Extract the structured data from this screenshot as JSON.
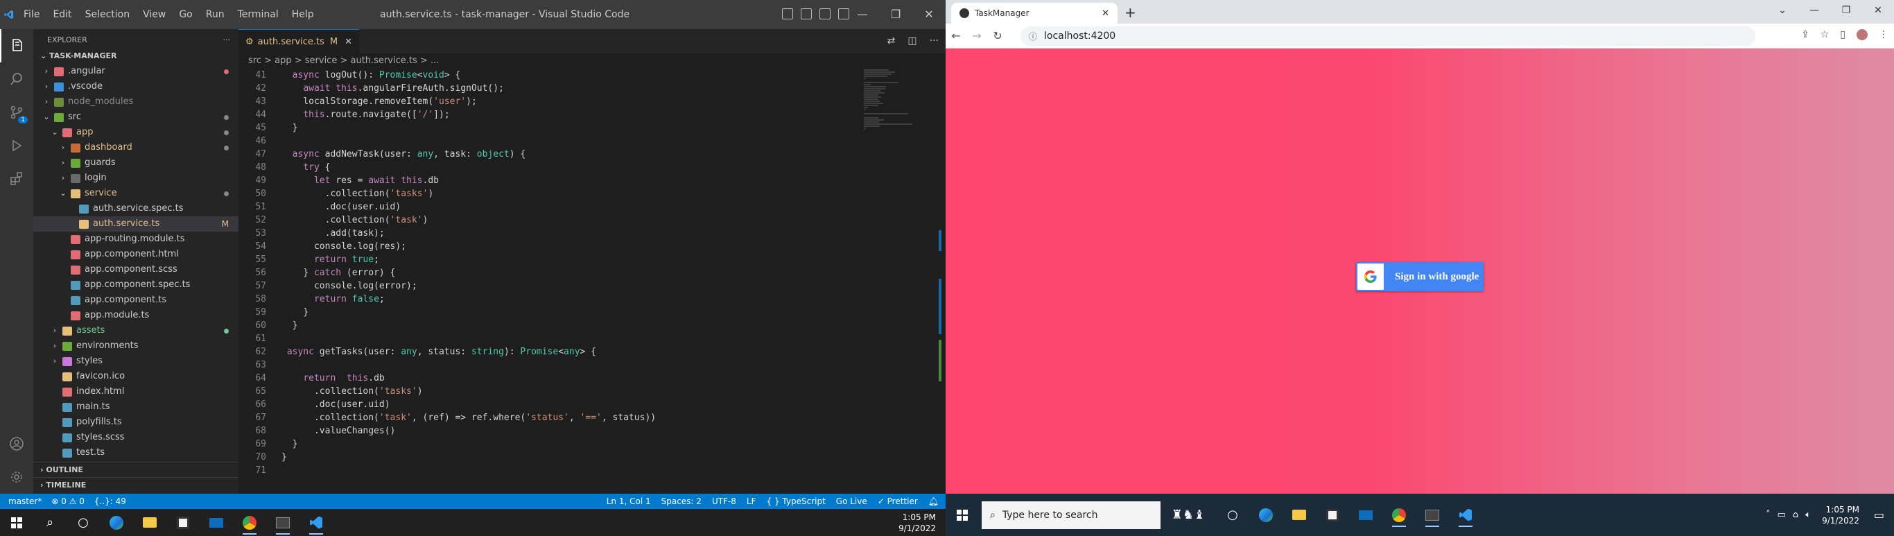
{
  "vscode": {
    "menu": [
      "File",
      "Edit",
      "Selection",
      "View",
      "Go",
      "Run",
      "Terminal",
      "Help"
    ],
    "window_title": "auth.service.ts - task-manager - Visual Studio Code",
    "explorer_label": "EXPLORER",
    "project_label": "TASK-MANAGER",
    "tree": [
      {
        "label": ".angular",
        "indent": 1,
        "chev": ">",
        "color": "#e06c75",
        "text": "#cccccc",
        "marker": "dot",
        "mcolor": "#e06c75"
      },
      {
        "label": ".vscode",
        "indent": 1,
        "chev": ">",
        "color": "#3c8fd6",
        "text": "#cccccc",
        "marker": "",
        "mcolor": ""
      },
      {
        "label": "node_modules",
        "indent": 1,
        "chev": ">",
        "color": "#6b8e3b",
        "text": "#8b8b8b",
        "marker": "",
        "mcolor": ""
      },
      {
        "label": "src",
        "indent": 1,
        "chev": "v",
        "color": "#6bab3e",
        "text": "#cccccc",
        "marker": "dot",
        "mcolor": "#888888"
      },
      {
        "label": "app",
        "indent": 2,
        "chev": "v",
        "color": "#e06c75",
        "text": "#e2c08d",
        "marker": "dot",
        "mcolor": "#888888"
      },
      {
        "label": "dashboard",
        "indent": 3,
        "chev": ">",
        "color": "#c76a3a",
        "text": "#e2c08d",
        "marker": "dot",
        "mcolor": "#888888"
      },
      {
        "label": "guards",
        "indent": 3,
        "chev": ">",
        "color": "#6bab3e",
        "text": "#cccccc",
        "marker": "",
        "mcolor": ""
      },
      {
        "label": "login",
        "indent": 3,
        "chev": ">",
        "color": "#6a6a6a",
        "text": "#cccccc",
        "marker": "",
        "mcolor": ""
      },
      {
        "label": "service",
        "indent": 3,
        "chev": "v",
        "color": "#e5c07b",
        "text": "#e2c08d",
        "marker": "dot",
        "mcolor": "#888888"
      },
      {
        "label": "auth.service.spec.ts",
        "indent": 4,
        "chev": "",
        "color": "#519aba",
        "text": "#cccccc",
        "marker": "",
        "mcolor": ""
      },
      {
        "label": "auth.service.ts",
        "indent": 4,
        "chev": "",
        "color": "#e5c07b",
        "text": "#e2c08d",
        "marker": "M",
        "mcolor": "#e2c08d",
        "selected": true
      },
      {
        "label": "app-routing.module.ts",
        "indent": 3,
        "chev": "",
        "color": "#e06c75",
        "text": "#cccccc",
        "marker": "",
        "mcolor": ""
      },
      {
        "label": "app.component.html",
        "indent": 3,
        "chev": "",
        "color": "#e06c75",
        "text": "#cccccc",
        "marker": "",
        "mcolor": ""
      },
      {
        "label": "app.component.scss",
        "indent": 3,
        "chev": "",
        "color": "#e06c75",
        "text": "#cccccc",
        "marker": "",
        "mcolor": ""
      },
      {
        "label": "app.component.spec.ts",
        "indent": 3,
        "chev": "",
        "color": "#519aba",
        "text": "#cccccc",
        "marker": "",
        "mcolor": ""
      },
      {
        "label": "app.component.ts",
        "indent": 3,
        "chev": "",
        "color": "#519aba",
        "text": "#cccccc",
        "marker": "",
        "mcolor": ""
      },
      {
        "label": "app.module.ts",
        "indent": 3,
        "chev": "",
        "color": "#e06c75",
        "text": "#cccccc",
        "marker": "",
        "mcolor": ""
      },
      {
        "label": "assets",
        "indent": 2,
        "chev": ">",
        "color": "#e5c07b",
        "text": "#73c991",
        "marker": "dot",
        "mcolor": "#73c991"
      },
      {
        "label": "environments",
        "indent": 2,
        "chev": ">",
        "color": "#6bab3e",
        "text": "#cccccc",
        "marker": "",
        "mcolor": ""
      },
      {
        "label": "styles",
        "indent": 2,
        "chev": ">",
        "color": "#c678dd",
        "text": "#cccccc",
        "marker": "",
        "mcolor": ""
      },
      {
        "label": "favicon.ico",
        "indent": 2,
        "chev": "",
        "color": "#e5c07b",
        "text": "#cccccc",
        "marker": "",
        "mcolor": ""
      },
      {
        "label": "index.html",
        "indent": 2,
        "chev": "",
        "color": "#e06c75",
        "text": "#cccccc",
        "marker": "",
        "mcolor": ""
      },
      {
        "label": "main.ts",
        "indent": 2,
        "chev": "",
        "color": "#519aba",
        "text": "#cccccc",
        "marker": "",
        "mcolor": ""
      },
      {
        "label": "polyfills.ts",
        "indent": 2,
        "chev": "",
        "color": "#519aba",
        "text": "#cccccc",
        "marker": "",
        "mcolor": ""
      },
      {
        "label": "styles.scss",
        "indent": 2,
        "chev": "",
        "color": "#519aba",
        "text": "#cccccc",
        "marker": "",
        "mcolor": ""
      },
      {
        "label": "test.ts",
        "indent": 2,
        "chev": "",
        "color": "#519aba",
        "text": "#cccccc",
        "marker": "",
        "mcolor": ""
      }
    ],
    "outline_label": "OUTLINE",
    "timeline_label": "TIMELINE",
    "tab_label": "auth.service.ts",
    "tab_status": "M",
    "breadcrumb": "src > app > service > auth.service.ts > ...",
    "code": [
      {
        "n": "41",
        "t": "  async logOut(): Promise<void> {"
      },
      {
        "n": "42",
        "t": "    await this.angularFireAuth.signOut();"
      },
      {
        "n": "43",
        "t": "    localStorage.removeItem('user');"
      },
      {
        "n": "44",
        "t": "    this.route.navigate(['/']);"
      },
      {
        "n": "45",
        "t": "  }"
      },
      {
        "n": "46",
        "t": ""
      },
      {
        "n": "47",
        "t": "  async addNewTask(user: any, task: object) {"
      },
      {
        "n": "48",
        "t": "    try {"
      },
      {
        "n": "49",
        "t": "      let res = await this.db"
      },
      {
        "n": "50",
        "t": "        .collection('tasks')"
      },
      {
        "n": "51",
        "t": "        .doc(user.uid)"
      },
      {
        "n": "52",
        "t": "        .collection('task')"
      },
      {
        "n": "53",
        "t": "        .add(task);"
      },
      {
        "n": "54",
        "t": "      console.log(res);"
      },
      {
        "n": "55",
        "t": "      return true;"
      },
      {
        "n": "56",
        "t": "    } catch (error) {"
      },
      {
        "n": "57",
        "t": "      console.log(error);"
      },
      {
        "n": "58",
        "t": "      return false;"
      },
      {
        "n": "59",
        "t": "    }"
      },
      {
        "n": "60",
        "t": "  }"
      },
      {
        "n": "61",
        "t": ""
      },
      {
        "n": "62",
        "t": " async getTasks(user: any, status: string): Promise<any> {"
      },
      {
        "n": "63",
        "t": ""
      },
      {
        "n": "64",
        "t": "    return  this.db"
      },
      {
        "n": "65",
        "t": "      .collection('tasks')"
      },
      {
        "n": "66",
        "t": "      .doc(user.uid)"
      },
      {
        "n": "67",
        "t": "      .collection('task', (ref) => ref.where('status', '==', status))"
      },
      {
        "n": "68",
        "t": "      .valueChanges()"
      },
      {
        "n": "69",
        "t": "  }"
      },
      {
        "n": "70",
        "t": "}"
      },
      {
        "n": "71",
        "t": ""
      }
    ],
    "status_left": [
      "master*",
      "⊗ 0  ⚠ 0",
      "{..}: 49"
    ],
    "status_right": [
      "Ln 1, Col 1",
      "Spaces: 2",
      "UTF-8",
      "LF",
      "{ } TypeScript",
      "Go Live",
      "✓ Prettier"
    ],
    "source_control_badge": "1"
  },
  "chrome": {
    "tab_title": "TaskManager",
    "url": "localhost:4200",
    "signin_label": "Sign in with google"
  },
  "taskbar": {
    "time": "1:05 PM",
    "date": "9/1/2022",
    "search_placeholder": "Type here to search"
  },
  "colors": {
    "page_bg": "#fd456d",
    "google_blue": "#4285f4",
    "vscode_status": "#007acc"
  }
}
